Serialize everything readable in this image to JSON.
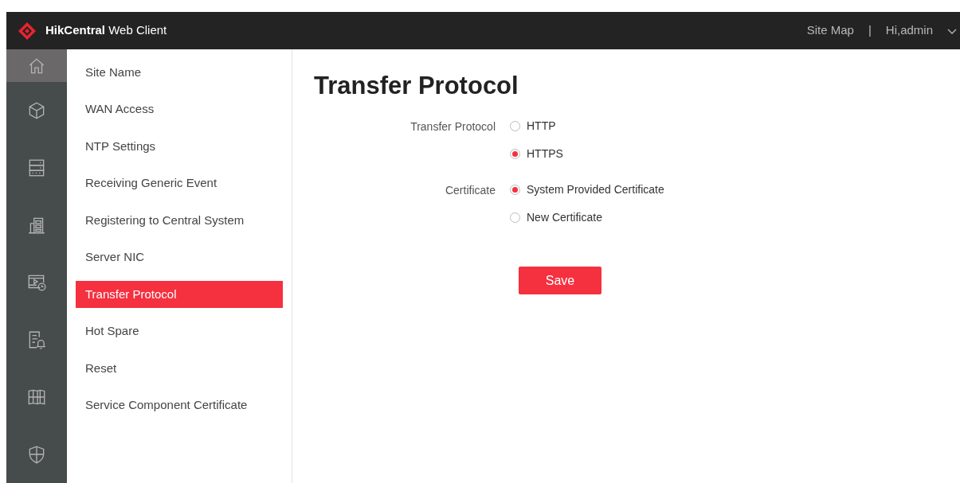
{
  "header": {
    "brand": "**HikCentral** Web Client",
    "links": [
      {
        "label": "Site Map"
      },
      {
        "label": "|"
      },
      {
        "label": "Hi,admin"
      }
    ]
  },
  "rail": [
    {
      "kind": "home",
      "selected": true
    },
    {
      "kind": "cube",
      "selected": false
    },
    {
      "kind": "server",
      "selected": false
    },
    {
      "kind": "building",
      "selected": false
    },
    {
      "kind": "video",
      "selected": false
    },
    {
      "kind": "alarm",
      "selected": false
    },
    {
      "kind": "map",
      "selected": false
    },
    {
      "kind": "shield",
      "selected": false
    }
  ],
  "menu": [
    {
      "label": "Site Name",
      "selected": false
    },
    {
      "label": "WAN Access",
      "selected": false
    },
    {
      "label": "NTP Settings",
      "selected": false
    },
    {
      "label": "Receiving Generic Event",
      "selected": false
    },
    {
      "label": "Registering to Central System",
      "selected": false
    },
    {
      "label": "Server NIC",
      "selected": false
    },
    {
      "label": "Transfer Protocol",
      "selected": true
    },
    {
      "label": "Hot Spare",
      "selected": false
    },
    {
      "label": "Reset",
      "selected": false
    },
    {
      "label": "Service Component Certificate",
      "selected": false
    }
  ],
  "page": {
    "title": "Transfer Protocol",
    "groups": [
      {
        "label": "Transfer Protocol",
        "options": [
          {
            "label": "HTTP",
            "selected": false
          },
          {
            "label": "HTTPS",
            "selected": true
          }
        ]
      },
      {
        "label": "Certificate",
        "options": [
          {
            "label": "System Provided Certificate",
            "selected": true
          },
          {
            "label": "New Certificate",
            "selected": false
          }
        ]
      }
    ],
    "save": "Save"
  }
}
